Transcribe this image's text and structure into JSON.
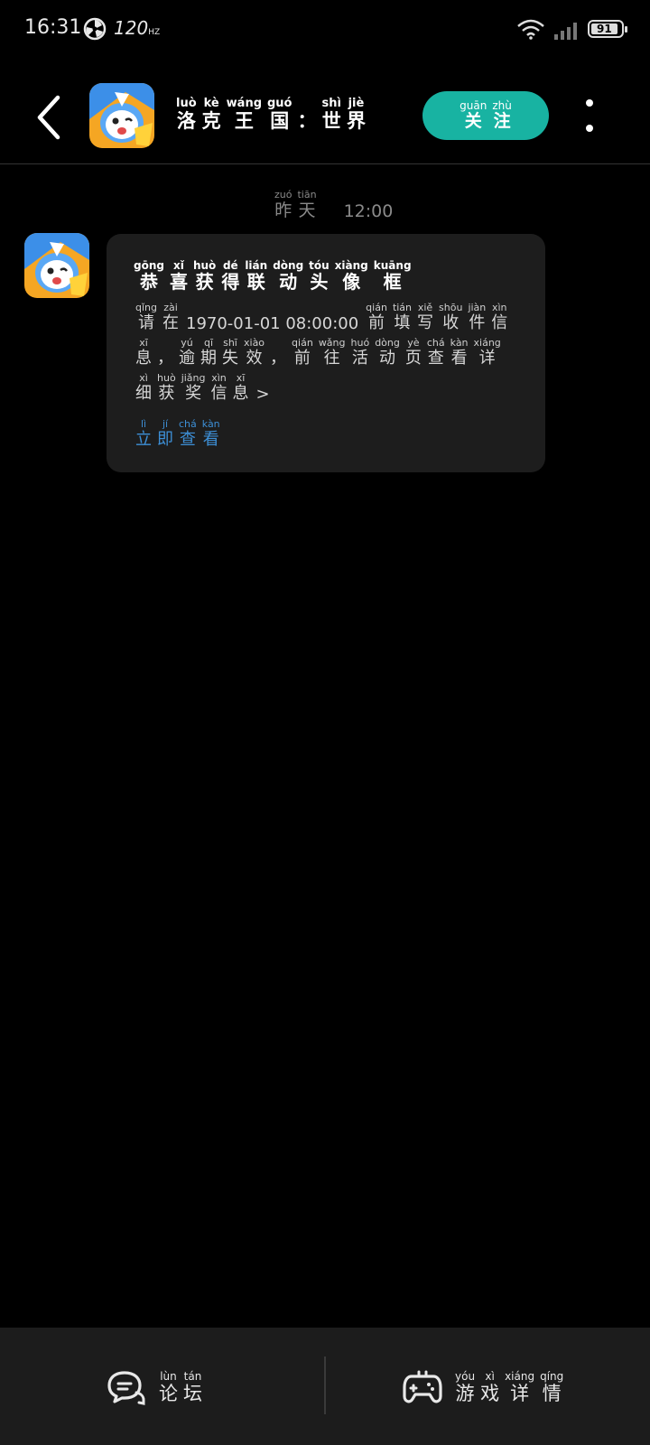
{
  "status_bar": {
    "time": "16:31",
    "refresh_rate": "120",
    "refresh_unit": "HZ",
    "battery": "91",
    "battery_level": 0.91
  },
  "header": {
    "title_chars": [
      {
        "py": "luò",
        "hz": "洛"
      },
      {
        "py": "kè",
        "hz": "克"
      },
      {
        "py": "wáng",
        "hz": "王"
      },
      {
        "py": "guó",
        "hz": "国"
      },
      {
        "py": "",
        "hz": "："
      },
      {
        "py": "shì",
        "hz": "世"
      },
      {
        "py": "jiè",
        "hz": "界"
      }
    ],
    "follow_chars": [
      {
        "py": "guān",
        "hz": "关"
      },
      {
        "py": "zhù",
        "hz": "注"
      }
    ]
  },
  "timestamp": {
    "day_chars": [
      {
        "py": "zuó",
        "hz": "昨"
      },
      {
        "py": "tiān",
        "hz": "天"
      }
    ],
    "time": "12:00"
  },
  "message": {
    "title_chars": [
      {
        "py": "gōng",
        "hz": "恭"
      },
      {
        "py": "xǐ",
        "hz": "喜"
      },
      {
        "py": "huò",
        "hz": "获"
      },
      {
        "py": "dé",
        "hz": "得"
      },
      {
        "py": "lián",
        "hz": "联"
      },
      {
        "py": "dòng",
        "hz": "动"
      },
      {
        "py": "tóu",
        "hz": "头"
      },
      {
        "py": "xiàng",
        "hz": "像"
      },
      {
        "py": "kuāng",
        "hz": "框"
      }
    ],
    "line1_a": [
      {
        "py": "qǐng",
        "hz": "请"
      },
      {
        "py": "zài",
        "hz": "在"
      }
    ],
    "line1_date": "1970-01-01 08:00:00",
    "line1_b": [
      {
        "py": "qián",
        "hz": "前"
      },
      {
        "py": "tián",
        "hz": "填"
      },
      {
        "py": "xiě",
        "hz": "写"
      },
      {
        "py": "shōu",
        "hz": "收"
      },
      {
        "py": "jiàn",
        "hz": "件"
      },
      {
        "py": "xìn",
        "hz": "信"
      }
    ],
    "line2": [
      {
        "py": "xī",
        "hz": "息"
      },
      {
        "py": "",
        "hz": "，"
      },
      {
        "py": "yú",
        "hz": "逾"
      },
      {
        "py": "qī",
        "hz": "期"
      },
      {
        "py": "shī",
        "hz": "失"
      },
      {
        "py": "xiào",
        "hz": "效"
      },
      {
        "py": "",
        "hz": "，"
      },
      {
        "py": "qián",
        "hz": "前"
      },
      {
        "py": "wǎng",
        "hz": "往"
      },
      {
        "py": "huó",
        "hz": "活"
      },
      {
        "py": "dòng",
        "hz": "动"
      },
      {
        "py": "yè",
        "hz": "页"
      },
      {
        "py": "chá",
        "hz": "查"
      },
      {
        "py": "kàn",
        "hz": "看"
      },
      {
        "py": "xiáng",
        "hz": "详"
      }
    ],
    "line3": [
      {
        "py": "xì",
        "hz": "细"
      },
      {
        "py": "huò",
        "hz": "获"
      },
      {
        "py": "jiǎng",
        "hz": "奖"
      },
      {
        "py": "xìn",
        "hz": "信"
      },
      {
        "py": "xī",
        "hz": "息"
      }
    ],
    "line3_suffix": ">",
    "cta_chars": [
      {
        "py": "lì",
        "hz": "立"
      },
      {
        "py": "jí",
        "hz": "即"
      },
      {
        "py": "chá",
        "hz": "查"
      },
      {
        "py": "kàn",
        "hz": "看"
      }
    ]
  },
  "bottom_bar": {
    "forum_chars": [
      {
        "py": "lùn",
        "hz": "论"
      },
      {
        "py": "tán",
        "hz": "坛"
      }
    ],
    "game_chars": [
      {
        "py": "yóu",
        "hz": "游"
      },
      {
        "py": "xì",
        "hz": "戏"
      },
      {
        "py": "xiáng",
        "hz": "详"
      },
      {
        "py": "qíng",
        "hz": "情"
      }
    ]
  },
  "icons": {
    "back": "chevron-left-icon",
    "more": "more-vertical-icon",
    "forum": "chat-bubble-icon",
    "game": "gamepad-icon"
  },
  "colors": {
    "accent": "#18b3a2",
    "link": "#3d8fd6",
    "card": "#1d1d1d",
    "bottom_bar": "#1c1c1c"
  }
}
